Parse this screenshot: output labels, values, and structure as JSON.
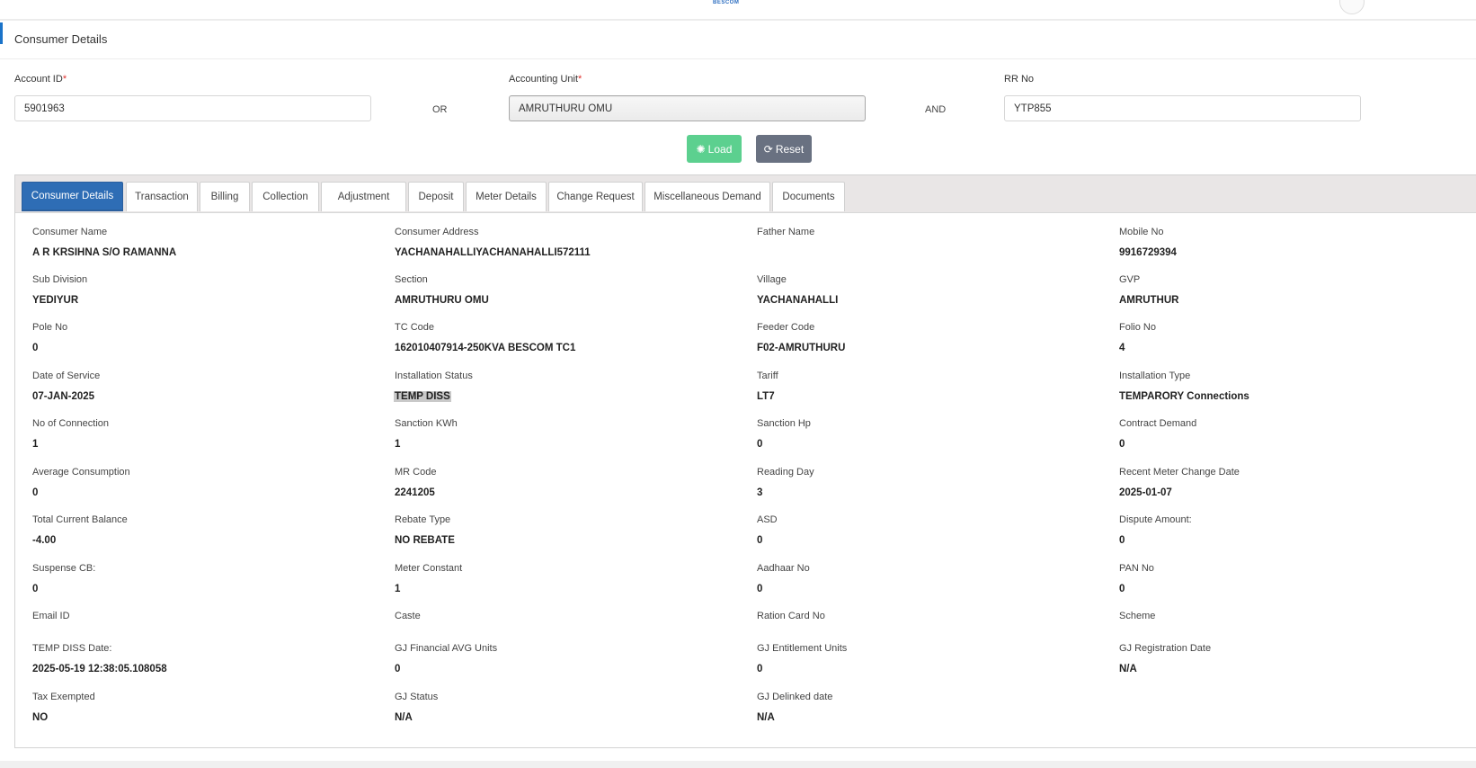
{
  "header": {
    "brand": "BESCOM",
    "title": "Consumer Details"
  },
  "search": {
    "account_id_label": "Account ID",
    "account_id_value": "5901963",
    "or_label": "OR",
    "accounting_unit_label": "Accounting Unit",
    "accounting_unit_value": "AMRUTHURU OMU",
    "and_label": "AND",
    "rr_no_label": "RR No",
    "rr_no_value": "YTP855",
    "required_mark": "*",
    "load_label": "Load",
    "reset_label": "Reset"
  },
  "tabs": [
    {
      "label": "Consumer Details",
      "active": true
    },
    {
      "label": "Transaction"
    },
    {
      "label": "Billing"
    },
    {
      "label": "Collection"
    },
    {
      "label": "Adjustment"
    },
    {
      "label": "Deposit"
    },
    {
      "label": "Meter Details"
    },
    {
      "label": "Change Request"
    },
    {
      "label": "Miscellaneous Demand"
    },
    {
      "label": "Documents"
    }
  ],
  "fields": [
    [
      {
        "label": "Consumer Name",
        "value": "A R KRSIHNA S/O RAMANNA"
      },
      {
        "label": "Consumer Address",
        "value": "YACHANAHALLIYACHANAHALLI572111"
      },
      {
        "label": "Father Name",
        "value": ""
      },
      {
        "label": "Mobile No",
        "value": "9916729394"
      }
    ],
    [
      {
        "label": "Sub Division",
        "value": "YEDIYUR"
      },
      {
        "label": "Section",
        "value": "AMRUTHURU OMU"
      },
      {
        "label": "Village",
        "value": "YACHANAHALLI"
      },
      {
        "label": "GVP",
        "value": "AMRUTHUR"
      }
    ],
    [
      {
        "label": "Pole No",
        "value": "0"
      },
      {
        "label": "TC Code",
        "value": "162010407914-250KVA BESCOM TC1"
      },
      {
        "label": "Feeder Code",
        "value": "F02-AMRUTHURU"
      },
      {
        "label": "Folio No",
        "value": "4"
      }
    ],
    [
      {
        "label": "Date of Service",
        "value": "07-JAN-2025"
      },
      {
        "label": "Installation Status",
        "value": "TEMP DISS",
        "highlight": true
      },
      {
        "label": "Tariff",
        "value": "LT7"
      },
      {
        "label": "Installation Type",
        "value": "TEMPARORY Connections"
      }
    ],
    [
      {
        "label": "No of Connection",
        "value": "1"
      },
      {
        "label": "Sanction KWh",
        "value": "1"
      },
      {
        "label": "Sanction Hp",
        "value": "0"
      },
      {
        "label": "Contract Demand",
        "value": "0"
      }
    ],
    [
      {
        "label": "Average Consumption",
        "value": "0"
      },
      {
        "label": "MR Code",
        "value": "2241205"
      },
      {
        "label": "Reading Day",
        "value": "3"
      },
      {
        "label": "Recent Meter Change Date",
        "value": "2025-01-07"
      }
    ],
    [
      {
        "label": "Total Current Balance",
        "value": "-4.00"
      },
      {
        "label": "Rebate Type",
        "value": "NO REBATE"
      },
      {
        "label": "ASD",
        "value": "0"
      },
      {
        "label": "Dispute Amount:",
        "value": "0"
      }
    ],
    [
      {
        "label": "Suspense CB:",
        "value": "0"
      },
      {
        "label": "Meter Constant",
        "value": "1"
      },
      {
        "label": "Aadhaar No",
        "value": "0"
      },
      {
        "label": "PAN No",
        "value": "0"
      }
    ],
    [
      {
        "label": "Email ID",
        "value": ""
      },
      {
        "label": "Caste",
        "value": ""
      },
      {
        "label": "Ration Card No",
        "value": ""
      },
      {
        "label": "Scheme",
        "value": ""
      }
    ],
    [
      {
        "label": "TEMP DISS Date:",
        "value": "2025-05-19 12:38:05.108058"
      },
      {
        "label": "GJ Financial AVG Units",
        "value": "0"
      },
      {
        "label": "GJ Entitlement Units",
        "value": "0"
      },
      {
        "label": "GJ Registration Date",
        "value": "N/A"
      }
    ],
    [
      {
        "label": "Tax Exempted",
        "value": "NO"
      },
      {
        "label": "GJ Status",
        "value": "N/A"
      },
      {
        "label": "GJ Delinked date",
        "value": "N/A"
      }
    ]
  ]
}
